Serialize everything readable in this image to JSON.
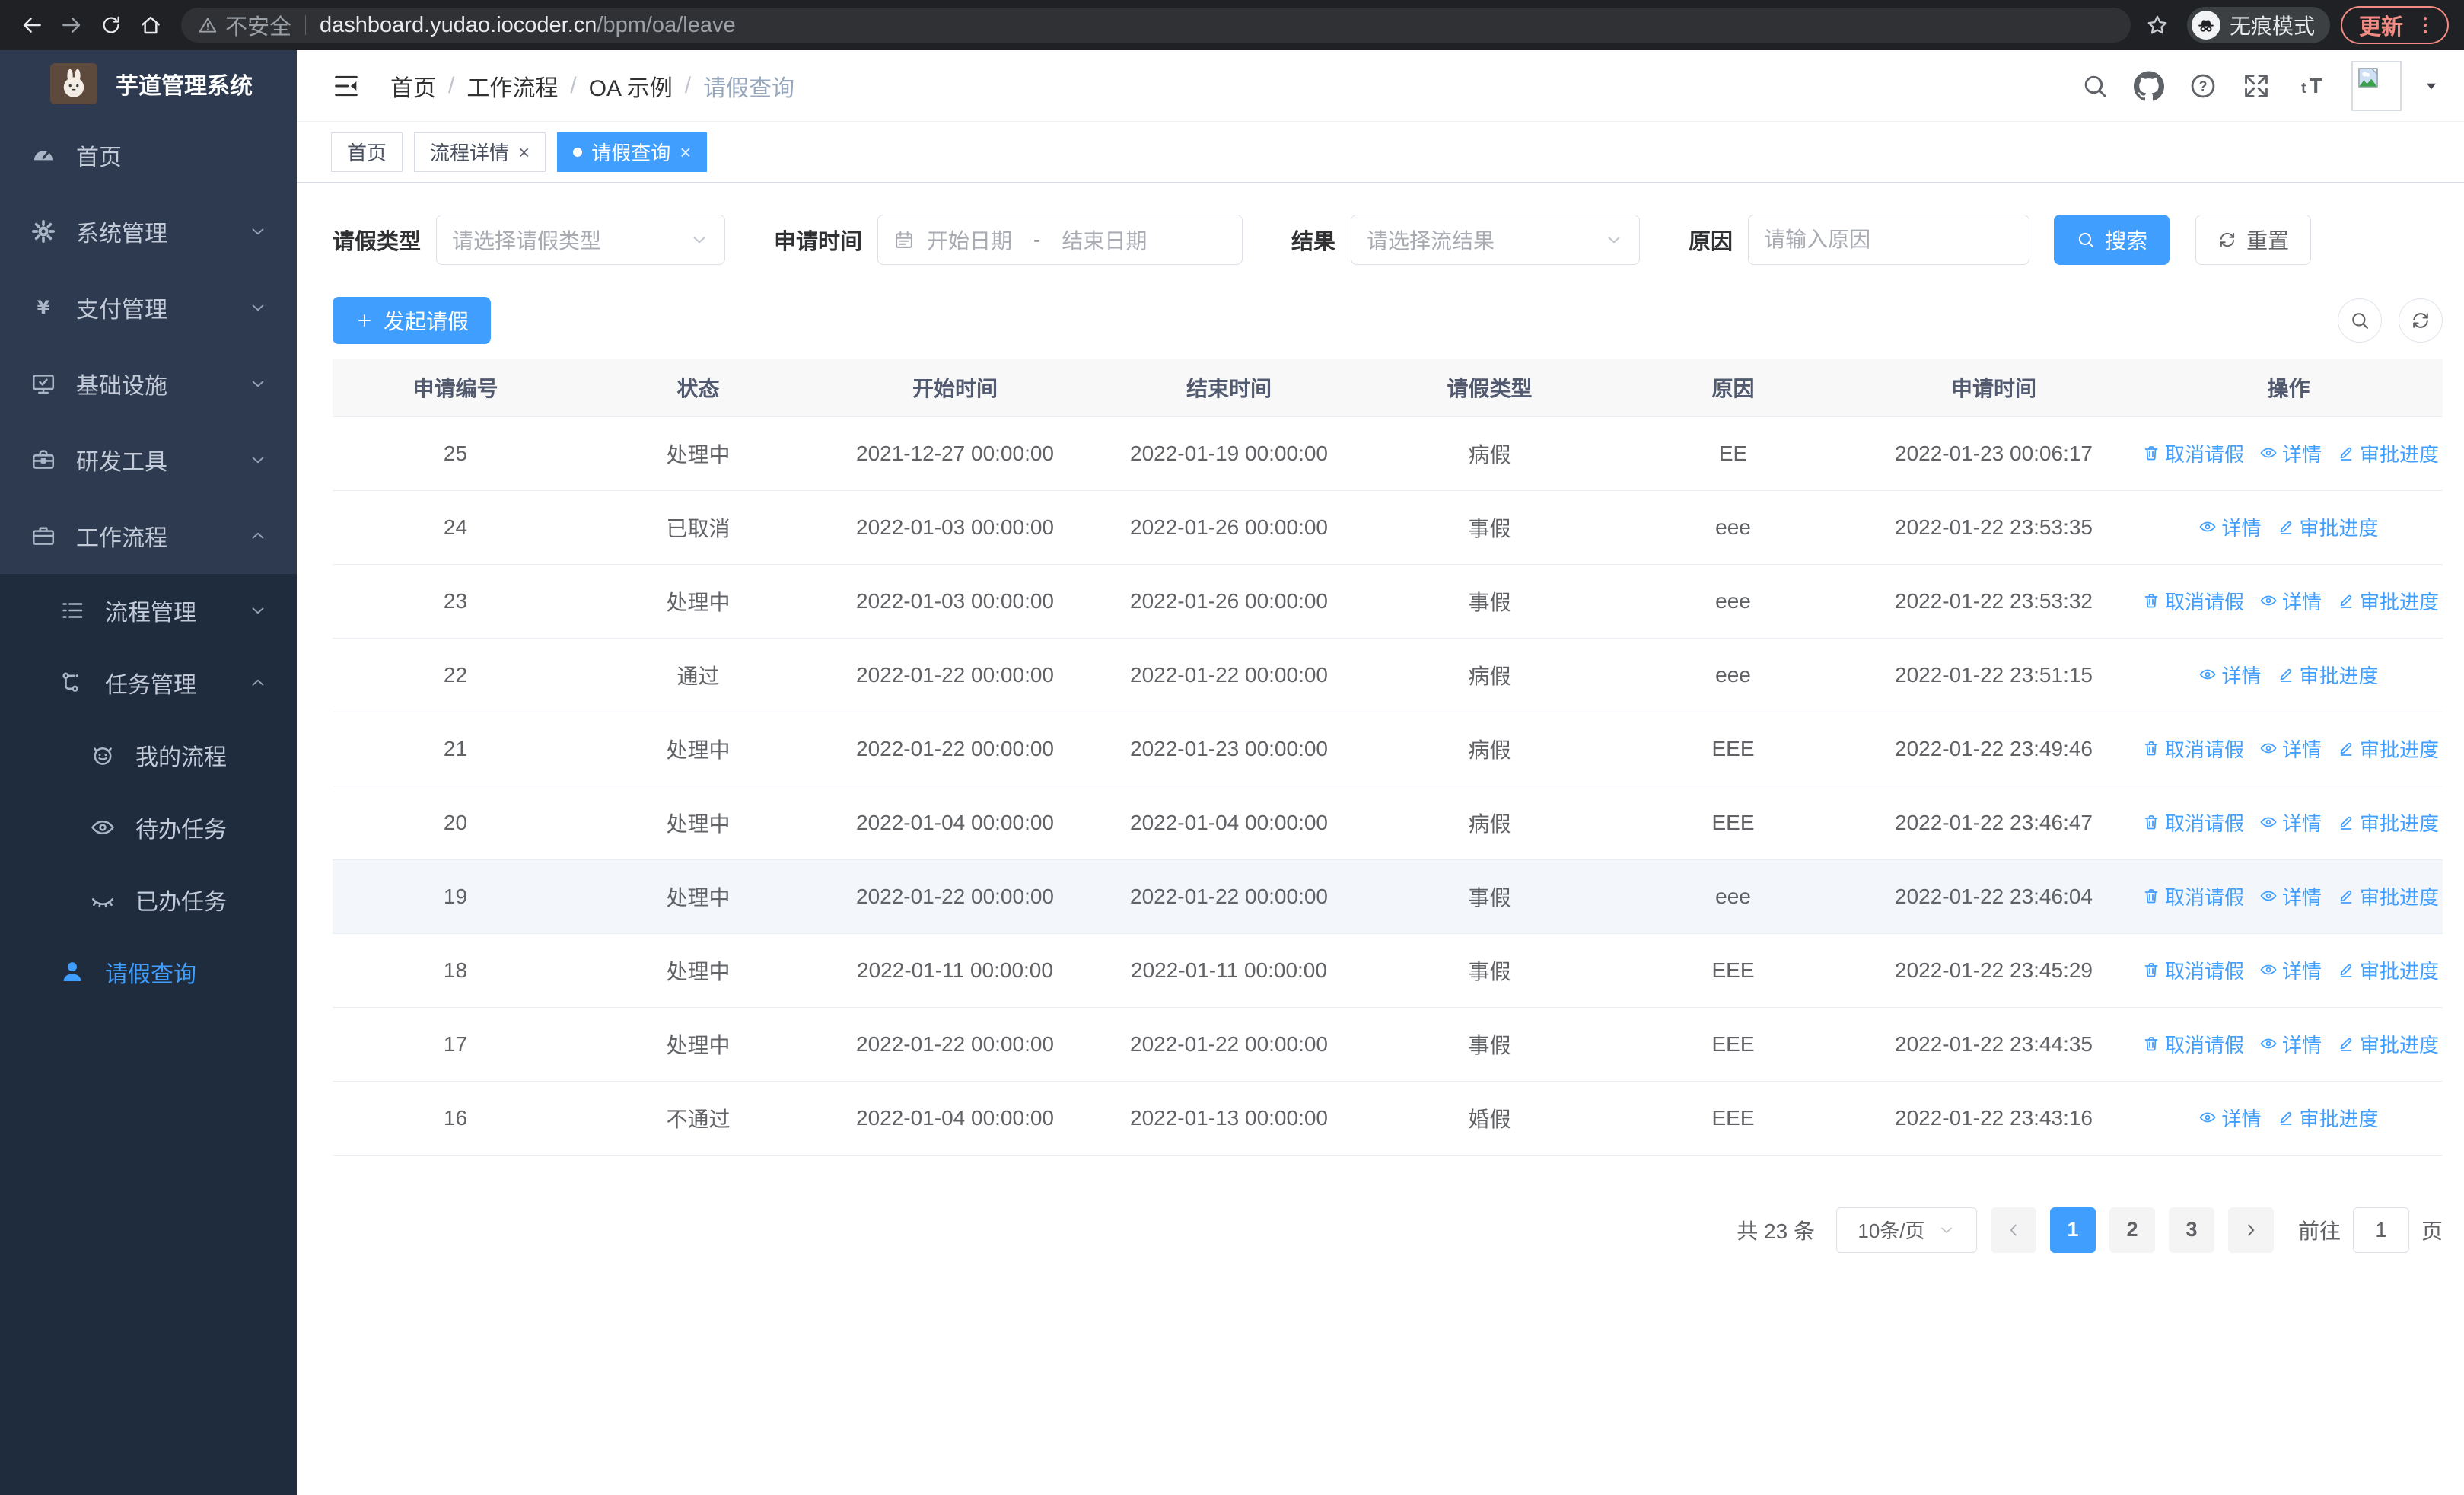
{
  "colors": {
    "primary": "#409eff",
    "sidebar_bg": "#2d3a4f",
    "submenu_bg": "#1f2c3d",
    "chrome_bg": "#202124",
    "update_accent": "#f28b82",
    "table_header_bg": "#f8f8f9",
    "row_highlight": "#f3f6fa"
  },
  "browser": {
    "security_label": "不安全",
    "url_host": "dashboard.yudao.iocoder.cn",
    "url_path": "/bpm/oa/leave",
    "incognito_label": "无痕模式",
    "update_label": "更新"
  },
  "sidebar": {
    "app_title": "芋道管理系统",
    "items": [
      {
        "key": "home",
        "label": "首页",
        "icon": "dashboard-icon",
        "arrow": ""
      },
      {
        "key": "system",
        "label": "系统管理",
        "icon": "gear-icon",
        "arrow": "down"
      },
      {
        "key": "payment",
        "label": "支付管理",
        "icon": "yen-icon",
        "arrow": "down"
      },
      {
        "key": "infrastructure",
        "label": "基础设施",
        "icon": "monitor-icon",
        "arrow": "down"
      },
      {
        "key": "devtools",
        "label": "研发工具",
        "icon": "toolbox-icon",
        "arrow": "down"
      },
      {
        "key": "workflow",
        "label": "工作流程",
        "icon": "briefcase-icon",
        "arrow": "up"
      }
    ],
    "submenu": [
      {
        "key": "process-management",
        "label": "流程管理",
        "icon": "list-icon",
        "arrow": "down",
        "level": 2,
        "active": false
      },
      {
        "key": "task-management",
        "label": "任务管理",
        "icon": "flow-icon",
        "arrow": "up",
        "level": 2,
        "active": false
      },
      {
        "key": "my-process",
        "label": "我的流程",
        "icon": "face-icon",
        "arrow": "",
        "level": 3,
        "active": false
      },
      {
        "key": "todo-tasks",
        "label": "待办任务",
        "icon": "eye-icon",
        "arrow": "",
        "level": 3,
        "active": false
      },
      {
        "key": "done-tasks",
        "label": "已办任务",
        "icon": "eye-closed-icon",
        "arrow": "",
        "level": 3,
        "active": false
      },
      {
        "key": "leave-query",
        "label": "请假查询",
        "icon": "user-icon",
        "arrow": "",
        "level": 2,
        "active": true
      }
    ]
  },
  "header": {
    "breadcrumb": [
      "首页",
      "工作流程",
      "OA 示例",
      "请假查询"
    ]
  },
  "tabs": [
    {
      "key": "home",
      "label": "首页",
      "closable": false,
      "active": false
    },
    {
      "key": "process-detail",
      "label": "流程详情",
      "closable": true,
      "active": false
    },
    {
      "key": "leave-query",
      "label": "请假查询",
      "closable": true,
      "active": true
    }
  ],
  "filters": {
    "leave_type_label": "请假类型",
    "leave_type_placeholder": "请选择请假类型",
    "apply_time_label": "申请时间",
    "start_date_placeholder": "开始日期",
    "range_separator": "-",
    "end_date_placeholder": "结束日期",
    "result_label": "结果",
    "result_placeholder": "请选择流结果",
    "reason_label": "原因",
    "reason_placeholder": "请输入原因",
    "search_button": "搜索",
    "reset_button": "重置"
  },
  "toolbar": {
    "create_label": "发起请假"
  },
  "table": {
    "columns": [
      "申请编号",
      "状态",
      "开始时间",
      "结束时间",
      "请假类型",
      "原因",
      "申请时间",
      "操作"
    ],
    "action_labels": {
      "cancel": "取消请假",
      "detail": "详情",
      "progress": "审批进度"
    },
    "rows": [
      {
        "id": "25",
        "status": "处理中",
        "start": "2021-12-27 00:00:00",
        "end": "2022-01-19 00:00:00",
        "type": "病假",
        "reason": "EE",
        "apply_time": "2022-01-23 00:06:17",
        "actions": [
          "cancel",
          "detail",
          "progress"
        ],
        "highlight": false
      },
      {
        "id": "24",
        "status": "已取消",
        "start": "2022-01-03 00:00:00",
        "end": "2022-01-26 00:00:00",
        "type": "事假",
        "reason": "eee",
        "apply_time": "2022-01-22 23:53:35",
        "actions": [
          "detail",
          "progress"
        ],
        "highlight": false
      },
      {
        "id": "23",
        "status": "处理中",
        "start": "2022-01-03 00:00:00",
        "end": "2022-01-26 00:00:00",
        "type": "事假",
        "reason": "eee",
        "apply_time": "2022-01-22 23:53:32",
        "actions": [
          "cancel",
          "detail",
          "progress"
        ],
        "highlight": false
      },
      {
        "id": "22",
        "status": "通过",
        "start": "2022-01-22 00:00:00",
        "end": "2022-01-22 00:00:00",
        "type": "病假",
        "reason": "eee",
        "apply_time": "2022-01-22 23:51:15",
        "actions": [
          "detail",
          "progress"
        ],
        "highlight": false
      },
      {
        "id": "21",
        "status": "处理中",
        "start": "2022-01-22 00:00:00",
        "end": "2022-01-23 00:00:00",
        "type": "病假",
        "reason": "EEE",
        "apply_time": "2022-01-22 23:49:46",
        "actions": [
          "cancel",
          "detail",
          "progress"
        ],
        "highlight": false
      },
      {
        "id": "20",
        "status": "处理中",
        "start": "2022-01-04 00:00:00",
        "end": "2022-01-04 00:00:00",
        "type": "病假",
        "reason": "EEE",
        "apply_time": "2022-01-22 23:46:47",
        "actions": [
          "cancel",
          "detail",
          "progress"
        ],
        "highlight": false
      },
      {
        "id": "19",
        "status": "处理中",
        "start": "2022-01-22 00:00:00",
        "end": "2022-01-22 00:00:00",
        "type": "事假",
        "reason": "eee",
        "apply_time": "2022-01-22 23:46:04",
        "actions": [
          "cancel",
          "detail",
          "progress"
        ],
        "highlight": true
      },
      {
        "id": "18",
        "status": "处理中",
        "start": "2022-01-11 00:00:00",
        "end": "2022-01-11 00:00:00",
        "type": "事假",
        "reason": "EEE",
        "apply_time": "2022-01-22 23:45:29",
        "actions": [
          "cancel",
          "detail",
          "progress"
        ],
        "highlight": false
      },
      {
        "id": "17",
        "status": "处理中",
        "start": "2022-01-22 00:00:00",
        "end": "2022-01-22 00:00:00",
        "type": "事假",
        "reason": "EEE",
        "apply_time": "2022-01-22 23:44:35",
        "actions": [
          "cancel",
          "detail",
          "progress"
        ],
        "highlight": false
      },
      {
        "id": "16",
        "status": "不通过",
        "start": "2022-01-04 00:00:00",
        "end": "2022-01-13 00:00:00",
        "type": "婚假",
        "reason": "EEE",
        "apply_time": "2022-01-22 23:43:16",
        "actions": [
          "detail",
          "progress"
        ],
        "highlight": false
      }
    ]
  },
  "pagination": {
    "total_label": "共 23 条",
    "page_size": "10条/页",
    "pages": [
      "1",
      "2",
      "3"
    ],
    "active_page": "1",
    "goto_label": "前往",
    "goto_value": "1",
    "unit_label": "页"
  }
}
